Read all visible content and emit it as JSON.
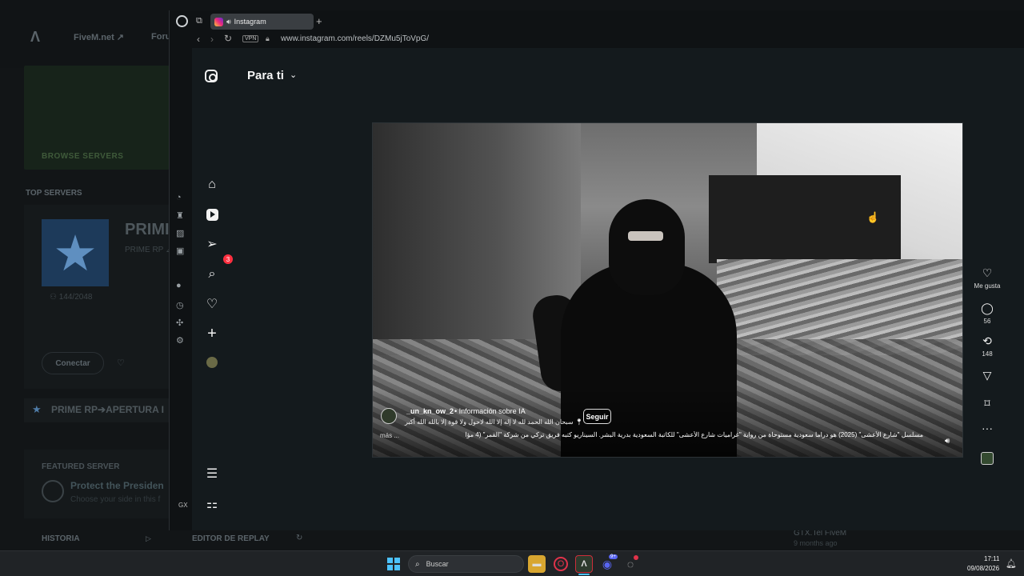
{
  "background_app": {
    "logo": "Λ",
    "links": [
      "FiveM.net ↗",
      "Foru"
    ],
    "browse_servers": "BROWSE SERVERS",
    "top_servers": "TOP SERVERS",
    "server": {
      "name": "PRIMI",
      "subtitle": "PRIME RP ⊿",
      "players": "144/2048",
      "connect": "Conectar"
    },
    "prime_row": "PRIME RP➔APERTURA I",
    "featured": {
      "heading": "FEATURED SERVER",
      "title": "Protect the Presiden",
      "subtitle": "Choose your side in this f"
    },
    "historia": "HISTORIA",
    "editor": "EDITOR DE REPLAY",
    "news_title": "GTX.Tel FiveM",
    "news_time": "9 months ago"
  },
  "browser": {
    "tab_title": "Instagram",
    "new_tab": "+",
    "vpn": "VPN",
    "url": "www.instagram.com/reels/DZMu5jToVpG/",
    "gx_label": "GX"
  },
  "instagram": {
    "feed_title": "Para ti",
    "messages_badge": "3",
    "post": {
      "username": "_un_kn_ow_2",
      "ai_label": "• Información sobre IA",
      "location": "سبحان الله الحمد لله لا إله إلا الله لاحول ولا قوة إلا بالله الله أكبر",
      "follow": "Seguir",
      "caption": "مسلسل \"شارع الأعشى\" (2025) هو دراما سعودية مستوحاة من رواية \"غراميات شارع الأعشى\" للكاتبة السعودية بدرية البشر. السيناريو كتبه فريق تركي من شركة \"القمر\" (4 مؤا",
      "more": "más ..."
    },
    "actions": {
      "like_label": "Me gusta",
      "comments": "56",
      "reposts": "148"
    }
  },
  "taskbar": {
    "search_placeholder": "Buscar",
    "discord_badge": "9+",
    "time": "17:11",
    "date": "09/08/2026"
  },
  "colors": {
    "instagram_badge": "#ff3040",
    "windows_accent": "#4cc2ff",
    "opera_red": "#e0334a"
  }
}
